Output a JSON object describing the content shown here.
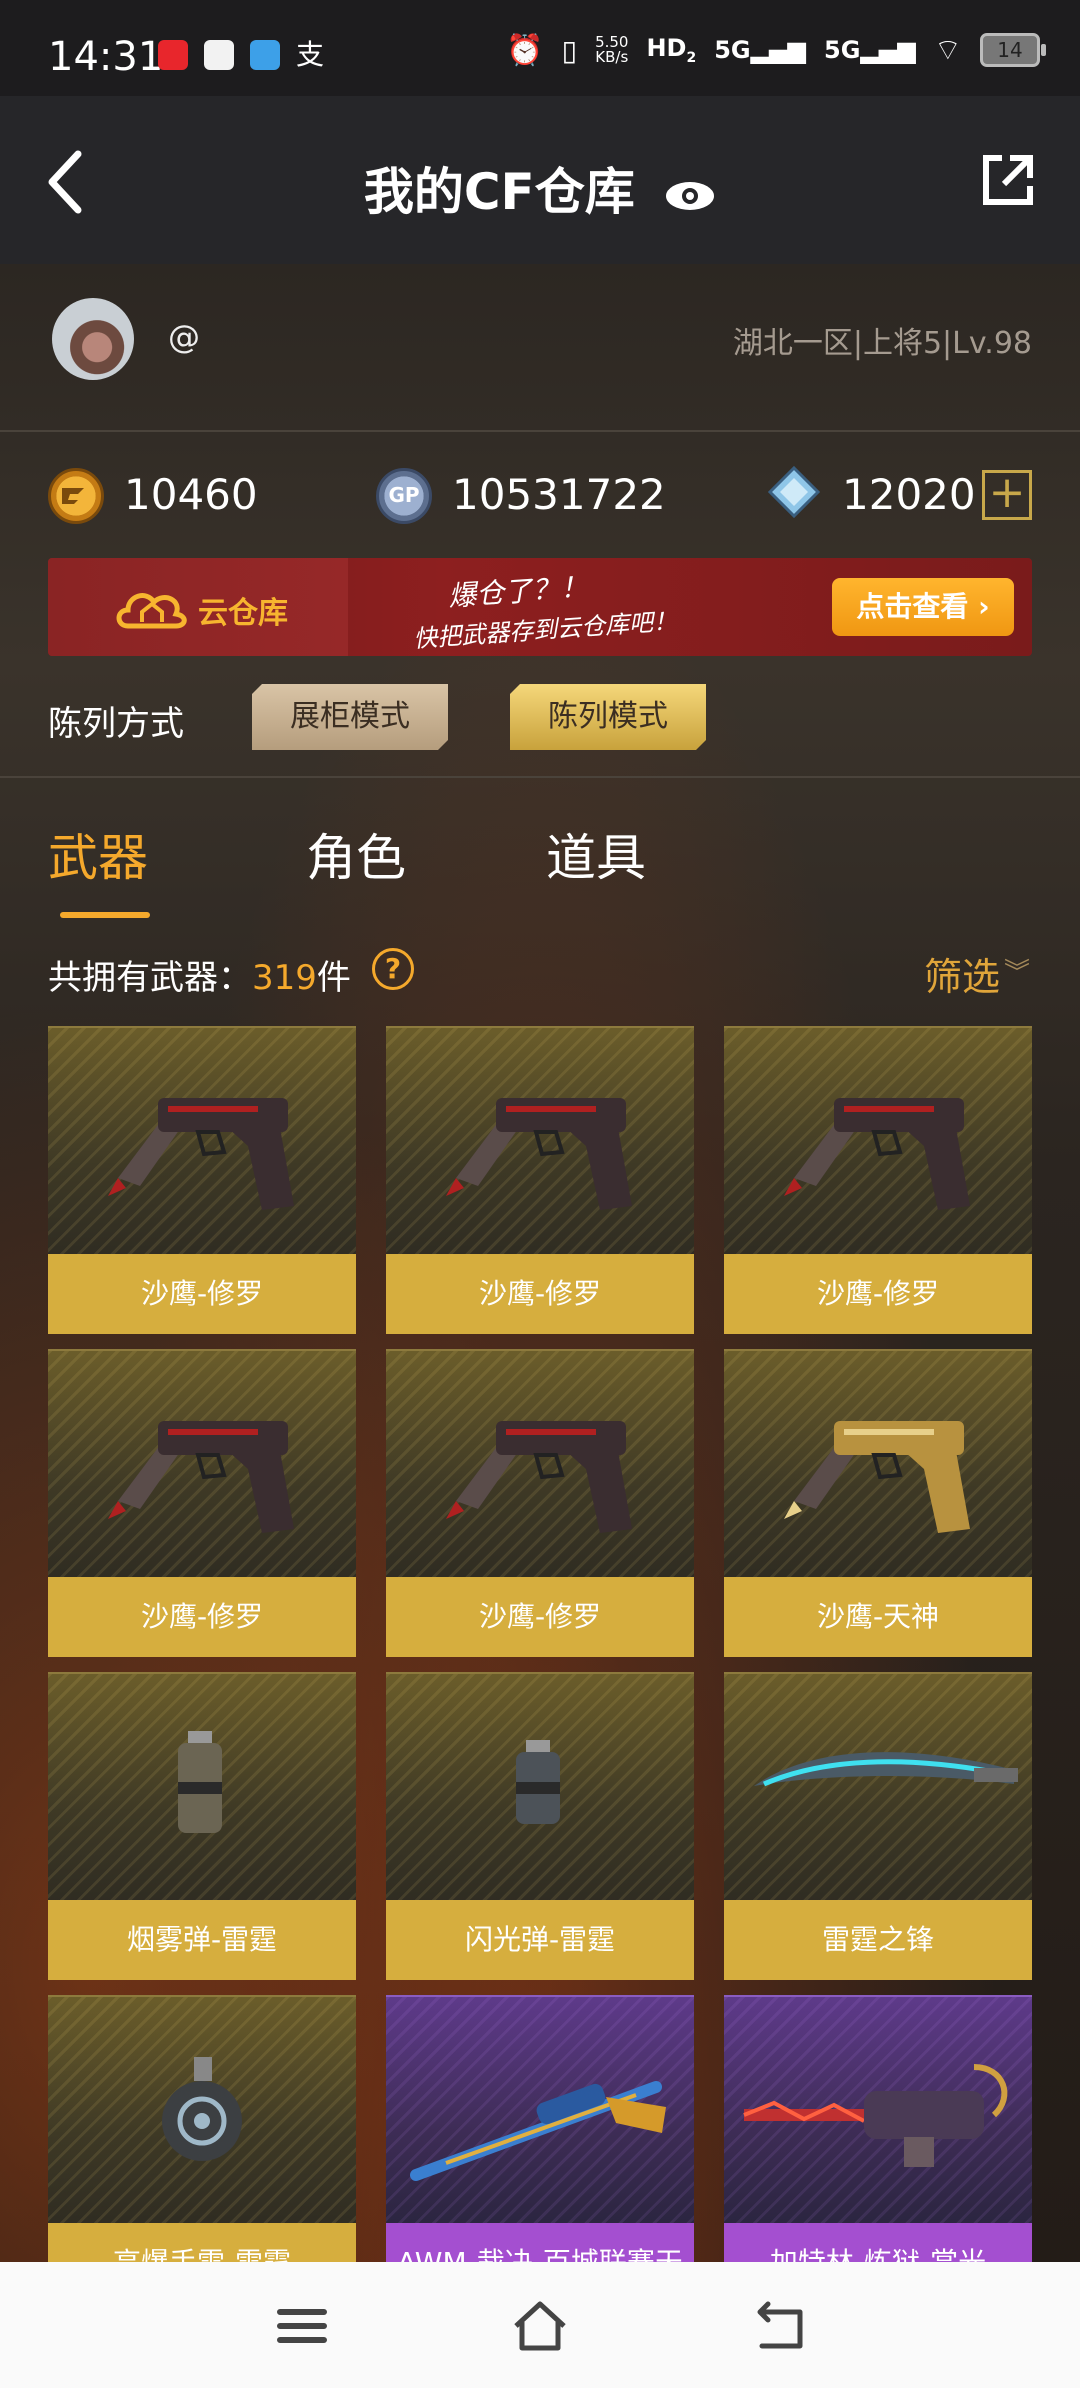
{
  "status_bar": {
    "time": "14:31",
    "net_speed_value": "5.50",
    "net_speed_unit": "KB/s",
    "hd": "HD",
    "hd_sub": "2",
    "signal1": "5G",
    "signal2": "5G",
    "battery": "14"
  },
  "nav": {
    "title": "我的CF仓库"
  },
  "profile": {
    "handle": "@",
    "server_info": "湖北一区|上将5|Lv.98"
  },
  "currency": {
    "cf_points": "10460",
    "gp": "10531722",
    "diamonds": "12020",
    "gp_icon_text": "GP"
  },
  "banner": {
    "cloud_label": "云仓库",
    "slogan_line1": "爆仓了？！",
    "slogan_line2": "快把武器存到云仓库吧！",
    "view_button": "点击查看",
    "view_arrow": "›"
  },
  "display_mode": {
    "label": "陈列方式",
    "option1": "展柜模式",
    "option2": "陈列模式"
  },
  "tabs": [
    "武器",
    "角色",
    "道具"
  ],
  "inventory": {
    "count_prefix": "共拥有武器：",
    "count": "319",
    "count_suffix": "件",
    "help": "?",
    "filter": "筛选"
  },
  "items": [
    {
      "name": "沙鹰-修罗"
    },
    {
      "name": "沙鹰-修罗"
    },
    {
      "name": "沙鹰-修罗"
    },
    {
      "name": "沙鹰-修罗"
    },
    {
      "name": "沙鹰-修罗"
    },
    {
      "name": "沙鹰-天神"
    },
    {
      "name": "烟雾弹-雷霆"
    },
    {
      "name": "闪光弹-雷霆"
    },
    {
      "name": "雷霆之锋"
    },
    {
      "name": "高爆手雷-雷霆"
    },
    {
      "name": "AWM-裁决-百城联赛天"
    },
    {
      "name": "加特林-炼狱-赏光"
    }
  ],
  "colors": {
    "accent": "#f5a92c",
    "gold_card": "#d6ae3e",
    "purple_card": "#a44fd0",
    "banner_red": "#8d1f1f"
  }
}
